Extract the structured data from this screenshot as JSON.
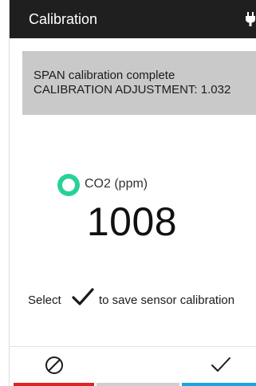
{
  "header": {
    "title": "Calibration",
    "bg_color": "#1f1f1f",
    "power_icon": "plug-icon"
  },
  "banner": {
    "line1": "SPAN calibration complete",
    "line2": "CALIBRATION ADJUSTMENT: 1.032",
    "bg_color": "#c9c9c9"
  },
  "sensor": {
    "status_icon": "sensor-status-icon",
    "status_color": "#28d19a",
    "label": "CO2 (ppm)",
    "reading": "1008"
  },
  "instruction": {
    "before": "Select",
    "icon": "checkmark-icon",
    "after": "to save sensor calibration"
  },
  "footer": {
    "cancel": {
      "icon": "cancel-icon",
      "bar_color": "#e02424"
    },
    "middle": {
      "bar_color": "#cfcfcf"
    },
    "confirm": {
      "icon": "checkmark-icon",
      "bar_color": "#1ea3e0"
    }
  }
}
